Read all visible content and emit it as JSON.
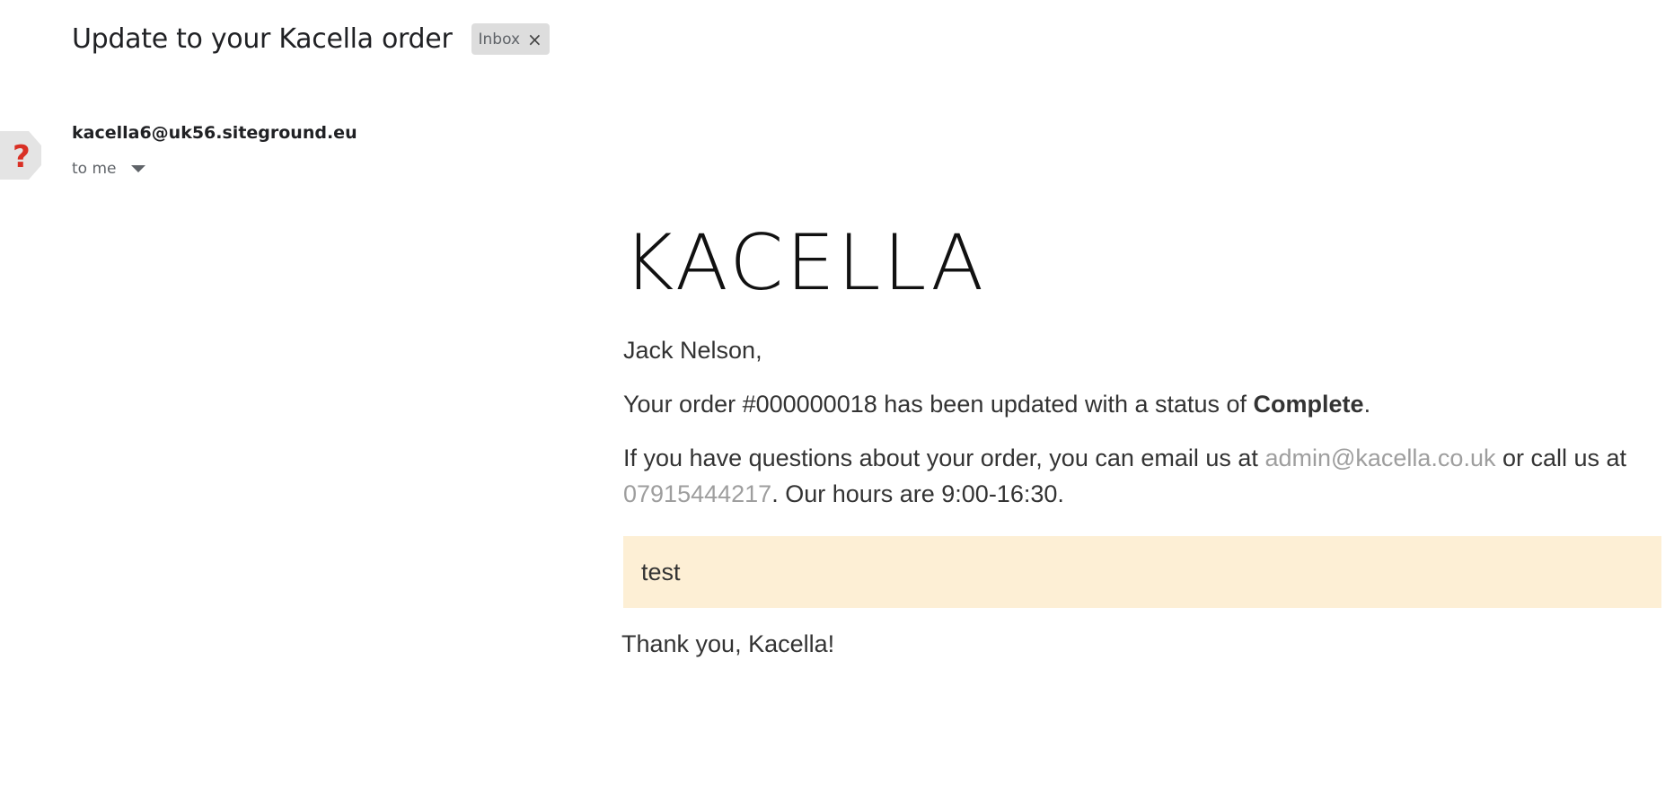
{
  "header": {
    "subject": "Update to your Kacella order",
    "label": "Inbox",
    "label_remove": "×"
  },
  "sender": {
    "avatar_icon": "question-mark-icon",
    "avatar_glyph": "?",
    "email": "kacella6@uk56.siteground.eu",
    "recipient": "to me"
  },
  "email": {
    "logo": "KACELLA",
    "greeting": "Jack Nelson,",
    "status_prefix": "Your order #000000018 has been updated with a status of ",
    "status_value": "Complete",
    "status_suffix": ".",
    "contact_prefix": "If you have questions about your order, you can email us at ",
    "contact_email": "admin@kacella.co.uk",
    "contact_middle": " or call us at ",
    "contact_phone": "07915444217",
    "contact_suffix": ". Our hours are 9:00-16:30.",
    "note": "test",
    "signoff": "Thank you, Kacella!"
  },
  "colors": {
    "link": "#9e9e9e",
    "note_background": "#fdefd5",
    "chip_background": "#dddddd",
    "avatar_accent": "#d93025"
  }
}
